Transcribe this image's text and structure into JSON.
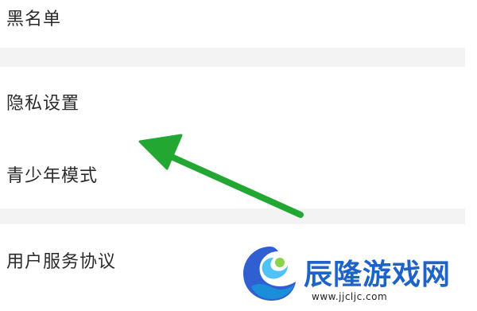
{
  "settings": {
    "items": [
      {
        "label": "黑名单"
      },
      {
        "label": "隐私设置"
      },
      {
        "label": "青少年模式"
      },
      {
        "label": "用户服务协议"
      }
    ]
  },
  "annotation": {
    "arrow_color": "#22a832",
    "points_to": "隐私设置"
  },
  "watermark": {
    "brand": "辰隆游戏网",
    "url": "www.jjcljc.com",
    "brand_color": "#1e63c6"
  }
}
